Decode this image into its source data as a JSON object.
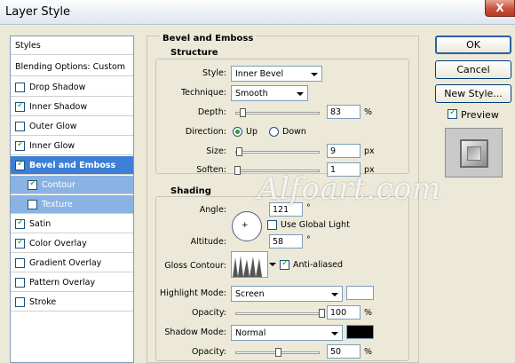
{
  "window": {
    "title": "Layer Style",
    "close_glyph": "X"
  },
  "styles_panel": {
    "header": "Styles",
    "blending": "Blending Options: Custom",
    "items": [
      {
        "label": "Drop Shadow",
        "checked": false
      },
      {
        "label": "Inner Shadow",
        "checked": true
      },
      {
        "label": "Outer Glow",
        "checked": false
      },
      {
        "label": "Inner Glow",
        "checked": true
      },
      {
        "label": "Bevel and Emboss",
        "checked": true,
        "selected": true
      },
      {
        "label": "Contour",
        "checked": true,
        "sub": true
      },
      {
        "label": "Texture",
        "checked": false,
        "sub": true
      },
      {
        "label": "Satin",
        "checked": true
      },
      {
        "label": "Color Overlay",
        "checked": true
      },
      {
        "label": "Gradient Overlay",
        "checked": false
      },
      {
        "label": "Pattern Overlay",
        "checked": false
      },
      {
        "label": "Stroke",
        "checked": false
      }
    ]
  },
  "bevel": {
    "title": "Bevel and Emboss",
    "structure": {
      "title": "Structure",
      "style_label": "Style:",
      "style_value": "Inner Bevel",
      "technique_label": "Technique:",
      "technique_value": "Smooth",
      "depth_label": "Depth:",
      "depth_value": "83",
      "depth_unit": "%",
      "depth_slider": 0.08,
      "direction_label": "Direction:",
      "dir_up": "Up",
      "dir_down": "Down",
      "size_label": "Size:",
      "size_value": "9",
      "size_unit": "px",
      "size_slider": 0.04,
      "soften_label": "Soften:",
      "soften_value": "1",
      "soften_unit": "px",
      "soften_slider": 0.02
    },
    "shading": {
      "title": "Shading",
      "angle_label": "Angle:",
      "angle_value": "121",
      "angle_unit": "°",
      "global_light_label": "Use Global Light",
      "global_light_checked": false,
      "altitude_label": "Altitude:",
      "altitude_value": "58",
      "altitude_unit": "°",
      "gloss_label": "Gloss Contour:",
      "anti_aliased_label": "Anti-aliased",
      "anti_aliased_checked": true,
      "highlight_mode_label": "Highlight Mode:",
      "highlight_mode_value": "Screen",
      "highlight_color": "#ffffff",
      "highlight_opacity_label": "Opacity:",
      "highlight_opacity_value": "100",
      "highlight_opacity_unit": "%",
      "highlight_opacity_slider": 1.0,
      "shadow_mode_label": "Shadow Mode:",
      "shadow_mode_value": "Normal",
      "shadow_color": "#000000",
      "shadow_opacity_label": "Opacity:",
      "shadow_opacity_value": "50",
      "shadow_opacity_unit": "%",
      "shadow_opacity_slider": 0.5
    }
  },
  "buttons": {
    "ok": "OK",
    "cancel": "Cancel",
    "new_style": "New Style..."
  },
  "preview": {
    "label": "Preview",
    "checked": true
  },
  "watermark": "Alfoart.com"
}
